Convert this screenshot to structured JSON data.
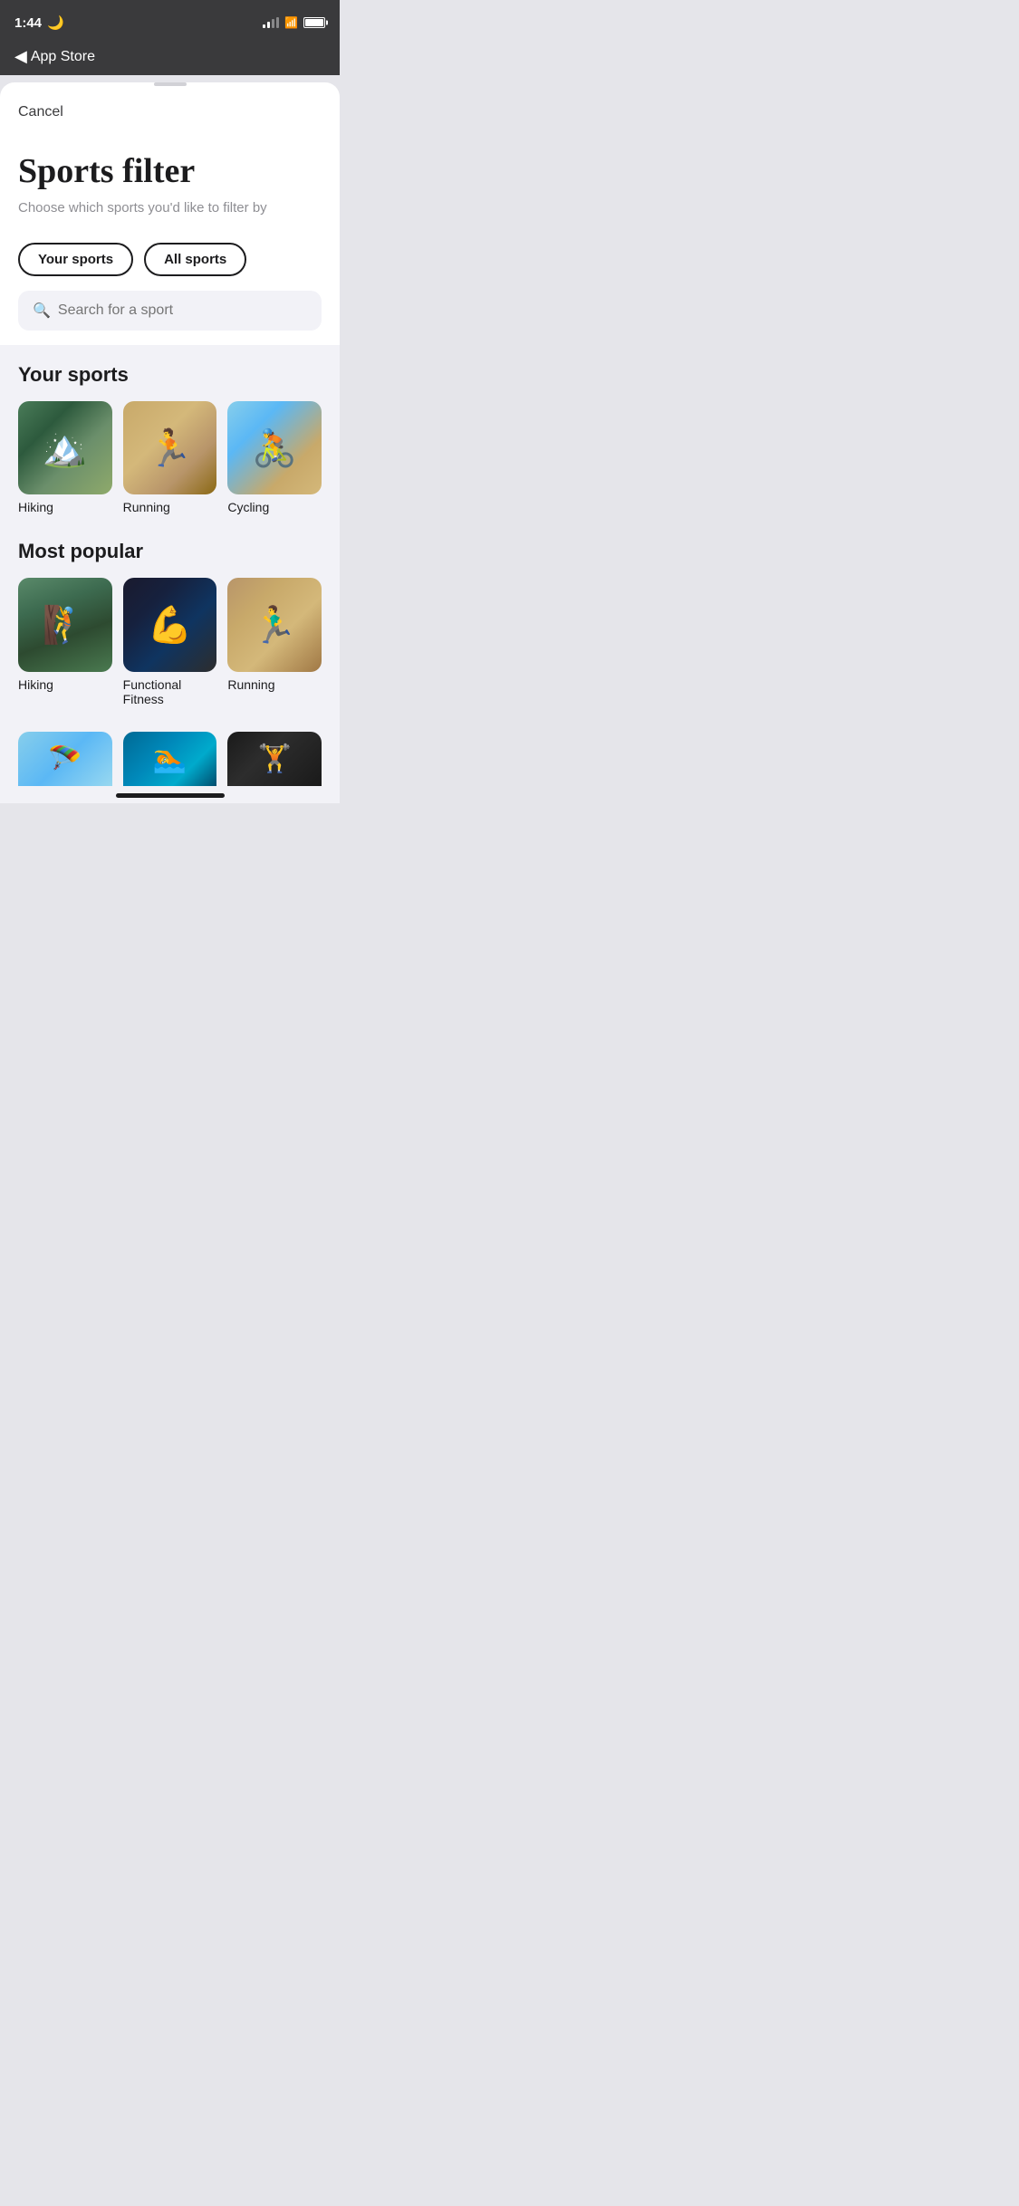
{
  "statusBar": {
    "time": "1:44",
    "moonIcon": "🌙"
  },
  "navBar": {
    "backLabel": "App Store",
    "backArrow": "◀"
  },
  "sheet": {
    "cancelLabel": "Cancel",
    "title": "Sports filter",
    "subtitle": "Choose which sports you'd like to filter by",
    "tabs": [
      {
        "label": "Your sports",
        "active": true
      },
      {
        "label": "All sports",
        "active": false
      }
    ],
    "searchPlaceholder": "Search for a sport"
  },
  "yourSports": {
    "sectionTitle": "Your sports",
    "items": [
      {
        "label": "Hiking",
        "imageClass": "img-hiking"
      },
      {
        "label": "Running",
        "imageClass": "img-running"
      },
      {
        "label": "Cycling",
        "imageClass": "img-cycling"
      }
    ]
  },
  "mostPopular": {
    "sectionTitle": "Most popular",
    "items": [
      {
        "label": "Hiking",
        "imageClass": "img-hiking-popular"
      },
      {
        "label": "Functional Fitness",
        "imageClass": "img-functional"
      },
      {
        "label": "Running",
        "imageClass": "img-running-popular"
      }
    ],
    "partialItems": [
      {
        "label": "",
        "imageClass": "img-sky"
      },
      {
        "label": "",
        "imageClass": "img-pool"
      },
      {
        "label": "",
        "imageClass": "img-gym"
      }
    ]
  }
}
